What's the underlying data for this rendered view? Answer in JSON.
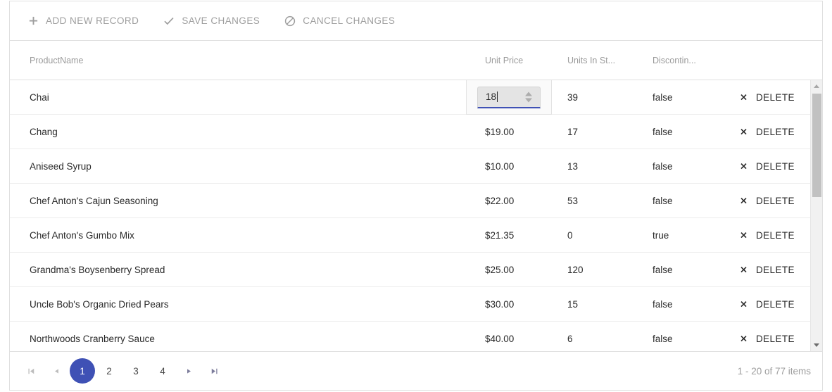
{
  "toolbar": {
    "buttons": [
      {
        "icon": "plus-icon",
        "label": "ADD NEW RECORD"
      },
      {
        "icon": "check-icon",
        "label": "SAVE CHANGES"
      },
      {
        "icon": "cancel-circle-icon",
        "label": "CANCEL CHANGES"
      }
    ]
  },
  "grid": {
    "columns": [
      {
        "key": "name",
        "label": "ProductName"
      },
      {
        "key": "price",
        "label": "Unit Price"
      },
      {
        "key": "units",
        "label": "Units In St..."
      },
      {
        "key": "disc",
        "label": "Discontin..."
      },
      {
        "key": "cmd",
        "label": ""
      }
    ],
    "delete_label": "DELETE",
    "delete_icon": "x-icon",
    "editing": {
      "row_index": 0,
      "column": "price",
      "value": "18",
      "spinner_up_icon": "caret-up-icon",
      "spinner_down_icon": "caret-down-icon"
    },
    "rows": [
      {
        "name": "Chai",
        "price": "$18.00",
        "units": "39",
        "disc": "false"
      },
      {
        "name": "Chang",
        "price": "$19.00",
        "units": "17",
        "disc": "false"
      },
      {
        "name": "Aniseed Syrup",
        "price": "$10.00",
        "units": "13",
        "disc": "false"
      },
      {
        "name": "Chef Anton's Cajun Seasoning",
        "price": "$22.00",
        "units": "53",
        "disc": "false"
      },
      {
        "name": "Chef Anton's Gumbo Mix",
        "price": "$21.35",
        "units": "0",
        "disc": "true"
      },
      {
        "name": "Grandma's Boysenberry Spread",
        "price": "$25.00",
        "units": "120",
        "disc": "false"
      },
      {
        "name": "Uncle Bob's Organic Dried Pears",
        "price": "$30.00",
        "units": "15",
        "disc": "false"
      },
      {
        "name": "Northwoods Cranberry Sauce",
        "price": "$40.00",
        "units": "6",
        "disc": "false"
      }
    ]
  },
  "scrollbar": {
    "up_icon": "scroll-up-arrow-icon",
    "down_icon": "scroll-down-arrow-icon"
  },
  "pager": {
    "first_icon": "go-to-first-page-icon",
    "prev_icon": "go-to-previous-page-icon",
    "next_icon": "go-to-next-page-icon",
    "last_icon": "go-to-last-page-icon",
    "first_glyph": "⏮",
    "prev_glyph": "◀",
    "next_glyph": "▶",
    "last_glyph": "⏭",
    "pages": [
      "1",
      "2",
      "3",
      "4"
    ],
    "active_page": "1",
    "info": "1 - 20 of 77 items"
  },
  "colors": {
    "accent": "#3f51b5",
    "border": "#e0e0e0",
    "row_border": "#ededed",
    "muted_text": "#9e9e9e",
    "body_text": "#292929"
  }
}
